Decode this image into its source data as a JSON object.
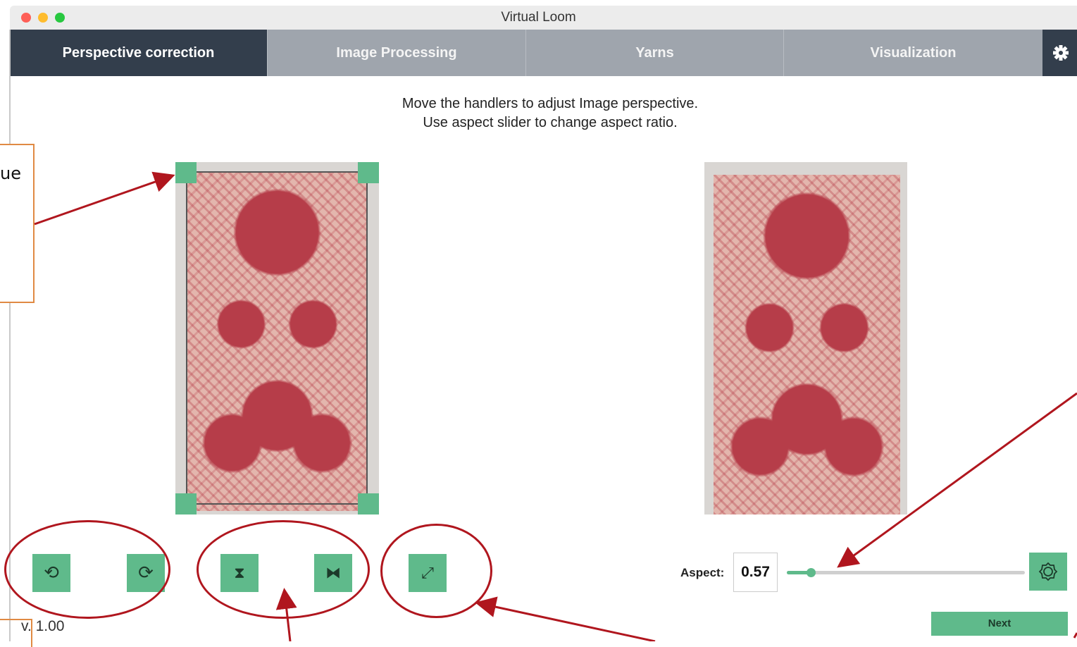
{
  "window": {
    "title": "Virtual Loom",
    "traffic_lights": [
      "#fe5f57",
      "#febc2e",
      "#28c840"
    ]
  },
  "tabs": [
    {
      "label": "Perspective correction",
      "active": true
    },
    {
      "label": "Image Processing",
      "active": false
    },
    {
      "label": "Yarns",
      "active": false
    },
    {
      "label": "Visualization",
      "active": false
    }
  ],
  "settings_icon": "gear-icon",
  "instructions": {
    "line1": "Move the handlers to adjust Image perspective.",
    "line2": "Use aspect slider to change aspect ratio."
  },
  "annotation": {
    "fragment": "ue"
  },
  "buttons": {
    "rotate_left_icon": "rotate-left-icon",
    "rotate_right_icon": "rotate-right-icon",
    "flip_vertical_icon": "flip-vertical-icon",
    "flip_horizontal_icon": "flip-horizontal-icon",
    "expand_icon": "expand-icon"
  },
  "aspect": {
    "label": "Aspect:",
    "value": "0.57",
    "slider_fraction": 0.1,
    "reset_icon": "gear-reset-icon"
  },
  "next_label": "Next",
  "version": "v. 1.00",
  "colors": {
    "accent": "#5fba8b",
    "active_tab": "#333e4c",
    "annotation": "#b0161e",
    "annotation_box": "#e08a43"
  }
}
